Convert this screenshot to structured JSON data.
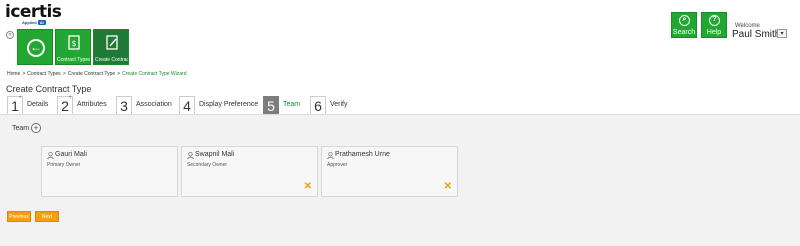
{
  "brand": {
    "logo_text": "icertis",
    "logo_sub": "Applied",
    "logo_badge": "AI"
  },
  "tiles": {
    "back_icon": "arrow-left-icon",
    "contract_types_label": "Contract Types",
    "create_label": "Create Contract T..."
  },
  "header": {
    "search_label": "Search",
    "help_label": "Help",
    "welcome": "Welcome",
    "user_name": "Paul Smith",
    "dropdown_glyph": "▾"
  },
  "breadcrumb": {
    "items": [
      "Home",
      "Contract Types",
      "Create Contract Type",
      "Create Contract Type Wizard"
    ],
    "separator": ">"
  },
  "page_title": "Create Contract Type",
  "steps": [
    {
      "num": "1",
      "label": "Details",
      "required": true
    },
    {
      "num": "2",
      "label": "Attributes",
      "required": true
    },
    {
      "num": "3",
      "label": "Association",
      "required": false
    },
    {
      "num": "4",
      "label": "Display Preference",
      "required": false
    },
    {
      "num": "5",
      "label": "Team",
      "required": false,
      "active": true
    },
    {
      "num": "6",
      "label": "Verify",
      "required": false
    }
  ],
  "team": {
    "label": "Team",
    "add_glyph": "+",
    "members": [
      {
        "name": "Gauri Mali",
        "role": "Primary Owner",
        "removable": false
      },
      {
        "name": "Swapnil Mali",
        "role": "Secondary Owner",
        "removable": true
      },
      {
        "name": "Prathamesh Urne",
        "role": "Approver",
        "removable": true
      }
    ]
  },
  "footer": {
    "previous_label": "Previous",
    "next_label": "Next"
  },
  "colors": {
    "accent_green": "#22a832",
    "orange": "#f0a010",
    "active_step": "#7d7d7d"
  }
}
